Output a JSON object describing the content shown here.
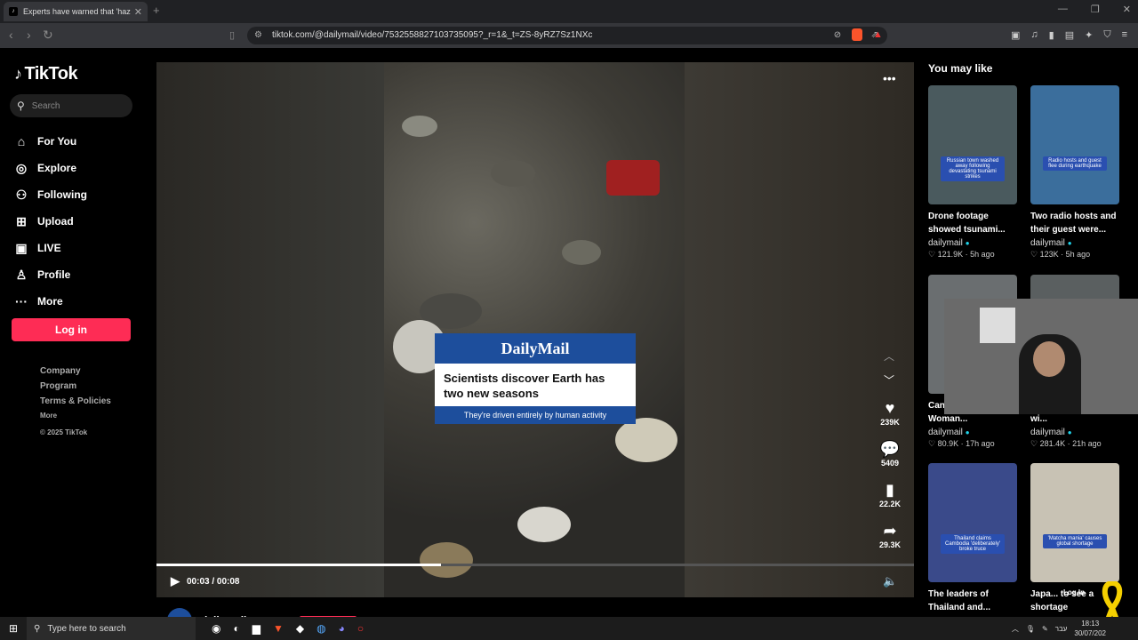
{
  "browser": {
    "tab_title": "Experts have warned that 'haze",
    "tab_close": "✕",
    "new_tab": "+",
    "url": "tiktok.com/@dailymail/video/7532558827103735095?_r=1&_t=ZS-8yRZ7Sz1NXc"
  },
  "sidebar": {
    "logo": "TikTok",
    "search_placeholder": "Search",
    "nav": [
      {
        "label": "For You",
        "icon": "home-icon"
      },
      {
        "label": "Explore",
        "icon": "compass-icon"
      },
      {
        "label": "Following",
        "icon": "user-icon"
      },
      {
        "label": "Upload",
        "icon": "plus-square-icon"
      },
      {
        "label": "LIVE",
        "icon": "live-icon"
      },
      {
        "label": "Profile",
        "icon": "profile-icon"
      },
      {
        "label": "More",
        "icon": "more-dots-icon"
      }
    ],
    "login_label": "Log in",
    "footer": {
      "company": "Company",
      "program": "Program",
      "terms": "Terms & Policies",
      "more": "More",
      "copyright": "© 2025 TikTok"
    }
  },
  "video": {
    "brand": "DailyMail",
    "headline": "Scientists discover Earth has two new seasons",
    "subline": "They're driven entirely by human activity",
    "time": "00:03 / 00:08",
    "progress_fraction": 0.375,
    "author": "dailymail",
    "actions": {
      "likes": "239K",
      "comments": "5409",
      "saves": "22.2K",
      "shares": "29.3K"
    }
  },
  "recommendations": {
    "heading": "You may like",
    "cards": [
      {
        "title": "Drone footage showed tsunami...",
        "author": "dailymail",
        "likes": "121.9K",
        "age": "5h ago",
        "thumb_label": "Russian town washed away following devastating tsunami strikes",
        "thumb_color": "#4a5a5e"
      },
      {
        "title": "Two radio hosts and their guest were...",
        "author": "dailymail",
        "likes": "123K",
        "age": "5h ago",
        "thumb_label": "Radio hosts and guest flee during earthquake",
        "thumb_color": "#3b6e9c"
      },
      {
        "title": "Can... call! 😅 Woman...",
        "author": "dailymail",
        "likes": "80.9K",
        "age": "17h ago",
        "thumb_label": "",
        "thumb_color": "#6a6e70"
      },
      {
        "title": "...romance rumors wi...",
        "author": "dailymail",
        "likes": "281.4K",
        "age": "21h ago",
        "thumb_label": "",
        "thumb_color": "#5a5f60"
      },
      {
        "title": "The leaders of Thailand and...",
        "author": "",
        "likes": "",
        "age": "",
        "thumb_label": "Thailand claims Cambodia 'deliberately' broke truce",
        "thumb_color": "#3a4a8a"
      },
      {
        "title": "Japa... to see a shortage",
        "author": "",
        "likes": "",
        "age": "",
        "thumb_label": "'Matcha mania' causes global shortage",
        "thumb_color": "#c8c2b4"
      }
    ]
  },
  "overlay_login": "Log In",
  "taskbar": {
    "search_placeholder": "Type here to search",
    "time": "18:13",
    "date": "30/07/202",
    "lang": "עבר"
  },
  "colors": {
    "accent": "#fe2c55",
    "dailymail_blue": "#1d4e9c",
    "verified": "#20d5ec"
  }
}
